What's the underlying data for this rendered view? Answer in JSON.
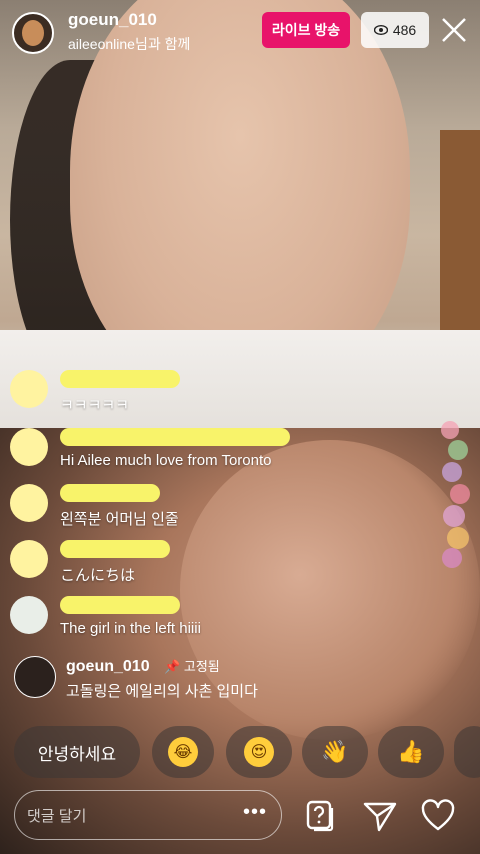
{
  "header": {
    "username": "goeun_010",
    "with_text": "aileeonline님과 함께",
    "live_button": "라이브 방송",
    "viewer_count": "486"
  },
  "comments": [
    {
      "text": "ㅋㅋㅋㅋㅋ"
    },
    {
      "text": "Hi Ailee much love from Toronto"
    },
    {
      "text": "왼쪽분 어머님 인줄"
    },
    {
      "text": "こんにちは"
    },
    {
      "text": "The girl in the left hiiii"
    }
  ],
  "pinned": {
    "username": "goeun_010",
    "pin_label": "고정됨",
    "text": "고돌링은 에일리의 사촌 입미다"
  },
  "quick_replies": {
    "text": "안녕하세요",
    "emojis": [
      "laugh-cry-emoji",
      "heart-eyes-emoji",
      "wave-emoji",
      "thumbs-up-emoji"
    ]
  },
  "input": {
    "placeholder": "댓글 달기",
    "more": "•••"
  },
  "colors": {
    "live": "#e8136a",
    "blur": "#f8f36a"
  }
}
